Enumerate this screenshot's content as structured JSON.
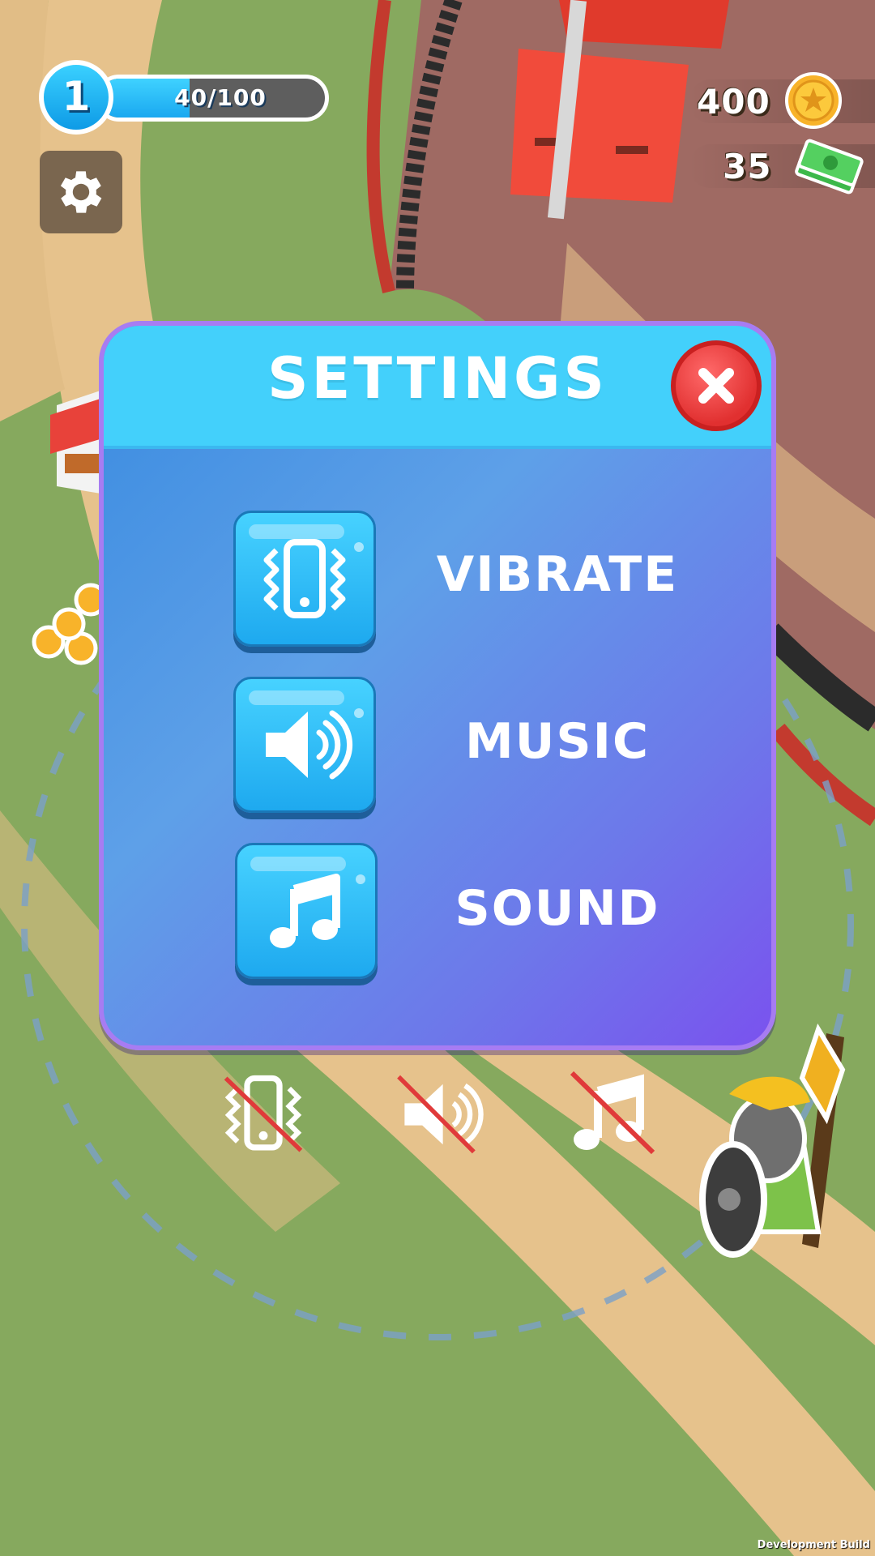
{
  "hud": {
    "level": "1",
    "xp_text": "40/100",
    "xp_progress": 0.4,
    "coins": "400",
    "cash": "35"
  },
  "settings_modal": {
    "title": "SETTINGS",
    "options": [
      {
        "label": "VIBRATE",
        "icon": "vibrate-icon"
      },
      {
        "label": "MUSIC",
        "icon": "speaker-icon"
      },
      {
        "label": "SOUND",
        "icon": "music-note-icon"
      }
    ]
  },
  "muted_indicators": [
    "vibrate-off-icon",
    "speaker-off-icon",
    "music-note-off-icon"
  ],
  "build_label": "Development Build",
  "colors": {
    "header": "#43d0fb",
    "button": "#2ab8f7",
    "close": "#e63a3a",
    "grass": "#86a95e",
    "path": "#e6c28c"
  }
}
